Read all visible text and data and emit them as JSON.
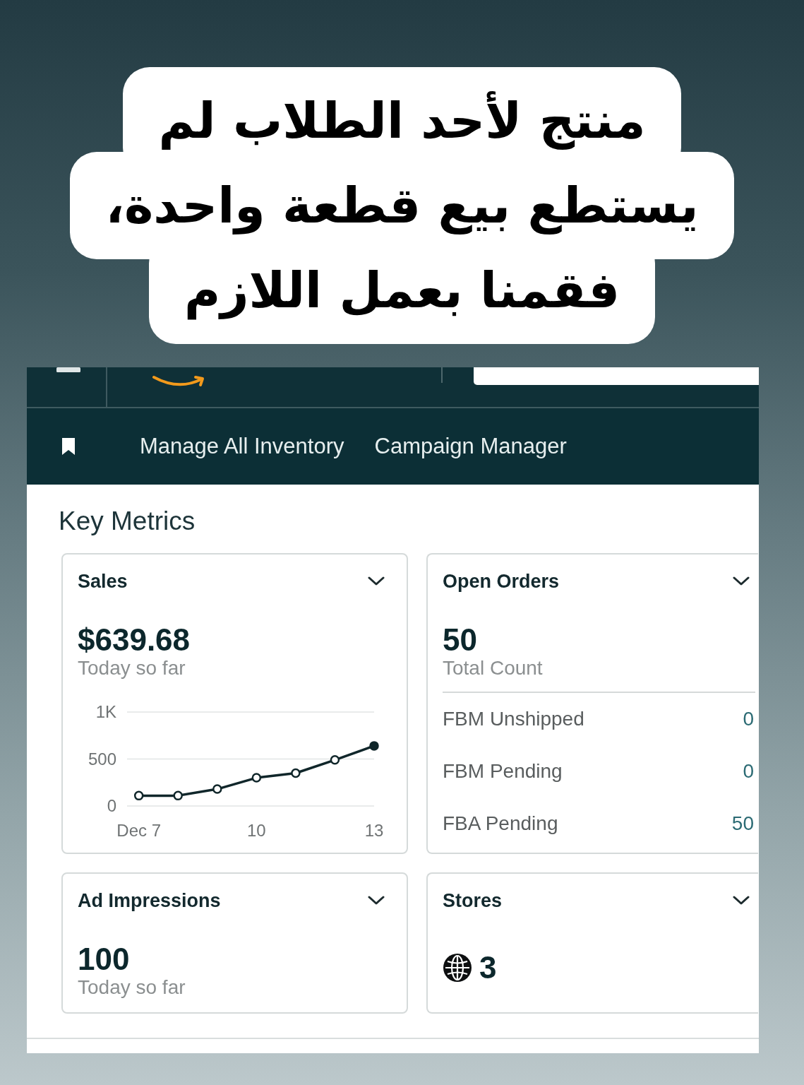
{
  "caption": {
    "lines": [
      "منتج لأحد الطلاب لم",
      "يستطع بيع قطعة واحدة،",
      "فقمنا بعمل اللازم"
    ]
  },
  "nav": {
    "links": [
      "Manage All Inventory",
      "Campaign Manager"
    ]
  },
  "key_metrics": {
    "title": "Key Metrics",
    "cards": [
      {
        "kind": "chart",
        "title": "Sales",
        "value": "$639.68",
        "caption": "Today so far",
        "chart_data": {
          "type": "line",
          "x": [
            7,
            8,
            9,
            10,
            11,
            12,
            13
          ],
          "values": [
            110,
            110,
            180,
            300,
            350,
            490,
            640
          ],
          "xlim": [
            6.7,
            13
          ],
          "ylim": [
            0,
            1000
          ],
          "yticks": [
            0,
            500,
            {
              "value": 1000,
              "label": "1K"
            }
          ],
          "xticks": [
            {
              "value": 7,
              "label": "Dec 7"
            },
            10,
            13
          ],
          "marker": "circle"
        }
      },
      {
        "kind": "breakdown",
        "title": "Open Orders",
        "value": "50",
        "caption": "Total Count",
        "rows": [
          {
            "label": "FBM Unshipped",
            "value": "0"
          },
          {
            "label": "FBM Pending",
            "value": "0"
          },
          {
            "label": "FBA Pending",
            "value": "50"
          }
        ]
      },
      {
        "kind": "simple",
        "title": "Ad Impressions",
        "value": "100",
        "caption": "Today so far"
      },
      {
        "kind": "globe",
        "title": "Stores",
        "value": "3"
      }
    ]
  }
}
